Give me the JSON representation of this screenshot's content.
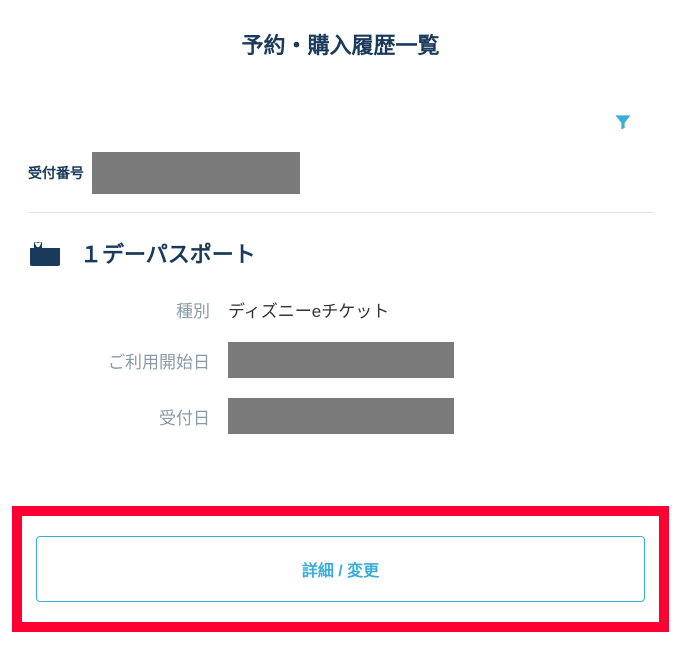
{
  "header": {
    "title": "予約・購入履歴一覧"
  },
  "receipt": {
    "label": "受付番号",
    "value": ""
  },
  "ticket": {
    "title": "１デーパスポート",
    "details": {
      "type_label": "種別",
      "type_value": "ディズニーeチケット",
      "start_date_label": "ご利用開始日",
      "start_date_value": "",
      "receipt_date_label": "受付日",
      "receipt_date_value": ""
    }
  },
  "actions": {
    "detail_change": "詳細 / 変更"
  }
}
